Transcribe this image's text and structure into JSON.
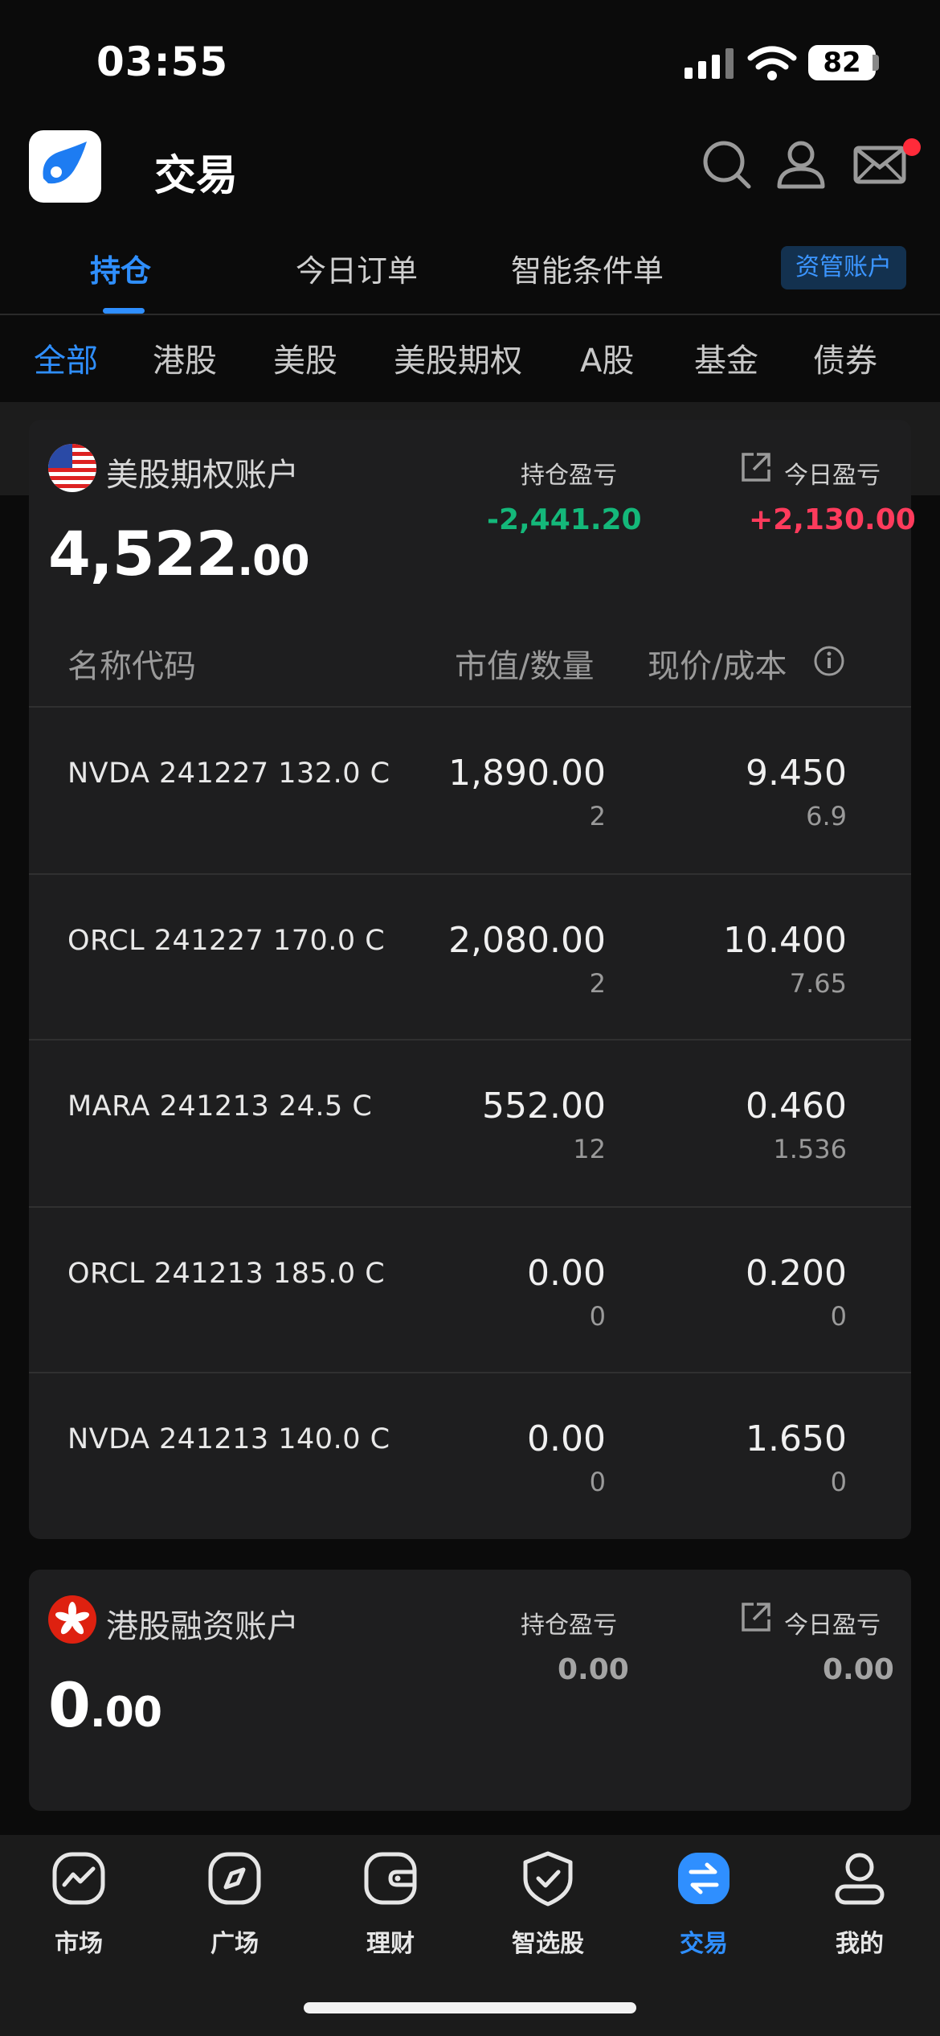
{
  "status_bar": {
    "time": "03:55",
    "battery": "82"
  },
  "header": {
    "title": "交易"
  },
  "tabs": [
    {
      "label": "持仓"
    },
    {
      "label": "今日订单"
    },
    {
      "label": "智能条件单"
    }
  ],
  "asset_button": "资管账户",
  "filters": [
    "全部",
    "港股",
    "美股",
    "美股期权",
    "A股",
    "基金",
    "债券"
  ],
  "us_options_account": {
    "name": "美股期权账户",
    "value_int": "4,522",
    "value_dec": ".00",
    "position_pl_label": "持仓盈亏",
    "position_pl": "-2,441.20",
    "today_pl_label": "今日盈亏",
    "today_pl": "+2,130.00",
    "columns": {
      "name": "名称代码",
      "market_qty": "市值/数量",
      "price_cost": "现价/成本"
    },
    "rows": [
      {
        "name": "NVDA 241227 132.0 C",
        "market_value": "1,890.00",
        "quantity": "2",
        "price": "9.450",
        "cost": "6.9"
      },
      {
        "name": "ORCL 241227 170.0 C",
        "market_value": "2,080.00",
        "quantity": "2",
        "price": "10.400",
        "cost": "7.65"
      },
      {
        "name": "MARA 241213 24.5 C",
        "market_value": "552.00",
        "quantity": "12",
        "price": "0.460",
        "cost": "1.536"
      },
      {
        "name": "ORCL 241213 185.0 C",
        "market_value": "0.00",
        "quantity": "0",
        "price": "0.200",
        "cost": "0"
      },
      {
        "name": "NVDA 241213 140.0 C",
        "market_value": "0.00",
        "quantity": "0",
        "price": "1.650",
        "cost": "0"
      }
    ]
  },
  "hk_margin_account": {
    "name": "港股融资账户",
    "value_int": "0",
    "value_dec": ".00",
    "position_pl_label": "持仓盈亏",
    "position_pl": "0.00",
    "today_pl_label": "今日盈亏",
    "today_pl": "0.00"
  },
  "bottom_nav": [
    {
      "label": "市场",
      "icon": "chart-icon"
    },
    {
      "label": "广场",
      "icon": "compass-icon"
    },
    {
      "label": "理财",
      "icon": "wallet-icon"
    },
    {
      "label": "智选股",
      "icon": "shield-check-icon"
    },
    {
      "label": "交易",
      "icon": "trade-icon"
    },
    {
      "label": "我的",
      "icon": "person-icon"
    }
  ],
  "colors": {
    "accent": "#2f8fff",
    "gain": "#ff3b5c",
    "loss": "#14b87a"
  }
}
